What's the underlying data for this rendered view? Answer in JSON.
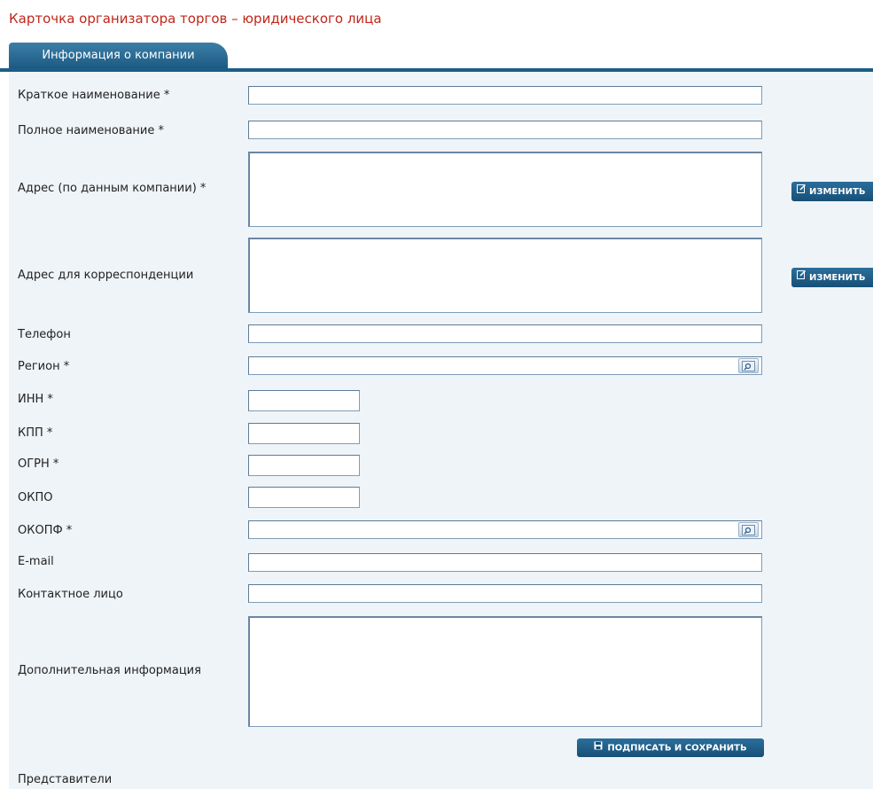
{
  "page": {
    "title": "Карточка организатора торгов – юридического лица"
  },
  "tabs": [
    {
      "label": "Информация о компании",
      "active": true
    }
  ],
  "fields": {
    "short_name": {
      "label": "Краткое наименование *",
      "value": ""
    },
    "full_name": {
      "label": "Полное наименование *",
      "value": ""
    },
    "company_address": {
      "label": "Адрес (по данным компании) *",
      "value": ""
    },
    "postal_address": {
      "label": "Адрес для корреспонденции",
      "value": ""
    },
    "phone": {
      "label": "Телефон",
      "value": ""
    },
    "region": {
      "label": "Регион *",
      "value": ""
    },
    "inn": {
      "label": "ИНН *",
      "value": ""
    },
    "kpp": {
      "label": "КПП *",
      "value": ""
    },
    "ogrn": {
      "label": "ОГРН *",
      "value": ""
    },
    "okpo": {
      "label": "ОКПО",
      "value": ""
    },
    "okopf": {
      "label": "ОКОПФ *",
      "value": ""
    },
    "email": {
      "label": "E-mail",
      "value": ""
    },
    "contact_person": {
      "label": "Контактное лицо",
      "value": ""
    },
    "additional_info": {
      "label": "Дополнительная информация",
      "value": ""
    }
  },
  "buttons": {
    "edit_label": "ИЗМЕНИТЬ",
    "sign_save_label": "ПОДПИСАТЬ И СОХРАНИТЬ"
  },
  "sections": {
    "representatives": "Представители"
  },
  "icons": {
    "edit": "edit-icon",
    "lookup": "lookup-icon",
    "save": "save-icon"
  },
  "colors": {
    "title": "#c0261b",
    "tab": "#1d5a82",
    "accent_bar": "#1b5e87",
    "panel": "#eff4f8",
    "button": "#174f76"
  }
}
